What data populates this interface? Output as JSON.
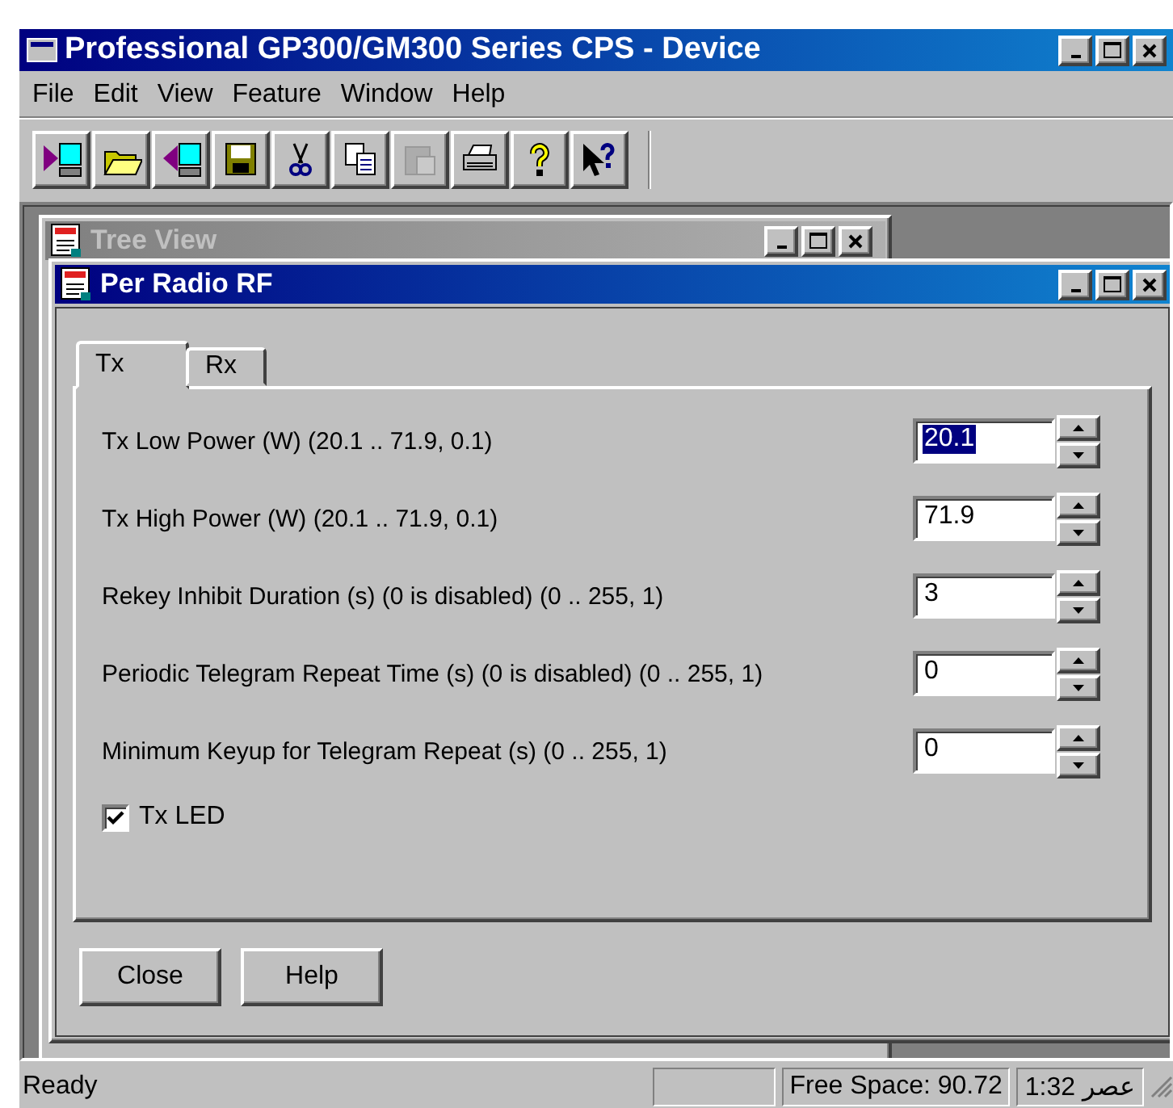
{
  "window": {
    "title": "Professional GP300/GM300 Series CPS - Device"
  },
  "menu": [
    "File",
    "Edit",
    "View",
    "Feature",
    "Window",
    "Help"
  ],
  "toolbar": [
    {
      "kind": "read",
      "disabled": false
    },
    {
      "kind": "open",
      "disabled": false
    },
    {
      "kind": "write",
      "disabled": false
    },
    {
      "kind": "save",
      "disabled": false
    },
    {
      "kind": "cut",
      "disabled": false
    },
    {
      "kind": "copy",
      "disabled": false
    },
    {
      "kind": "paste",
      "disabled": true
    },
    {
      "kind": "print",
      "disabled": false
    },
    {
      "kind": "help",
      "disabled": false
    },
    {
      "kind": "context-help",
      "disabled": false
    }
  ],
  "background_window": {
    "title": "Tree View"
  },
  "dialog": {
    "title": "Per Radio RF",
    "tabs": [
      {
        "label": "Tx",
        "selected": true
      },
      {
        "label": "Rx",
        "selected": false
      }
    ],
    "fields": [
      {
        "label": "Tx Low Power (W) (20.1 .. 71.9, 0.1)",
        "value": "20.1",
        "selected": true
      },
      {
        "label": "Tx High Power (W) (20.1 .. 71.9, 0.1)",
        "value": "71.9",
        "selected": false
      },
      {
        "label": "Rekey Inhibit Duration (s) (0 is disabled) (0 .. 255, 1)",
        "value": "3",
        "selected": false
      },
      {
        "label": "Periodic Telegram Repeat Time (s) (0 is disabled) (0 .. 255, 1)",
        "value": "0",
        "selected": false
      },
      {
        "label": "Minimum Keyup for Telegram Repeat (s) (0 .. 255, 1)",
        "value": "0",
        "selected": false
      }
    ],
    "checkbox": {
      "label": "Tx LED",
      "checked": true
    },
    "buttons": [
      "Close",
      "Help"
    ]
  },
  "status_bar": {
    "message": "Ready",
    "free_space": "Free Space: 90.72",
    "clock": "1:32 عصر"
  }
}
